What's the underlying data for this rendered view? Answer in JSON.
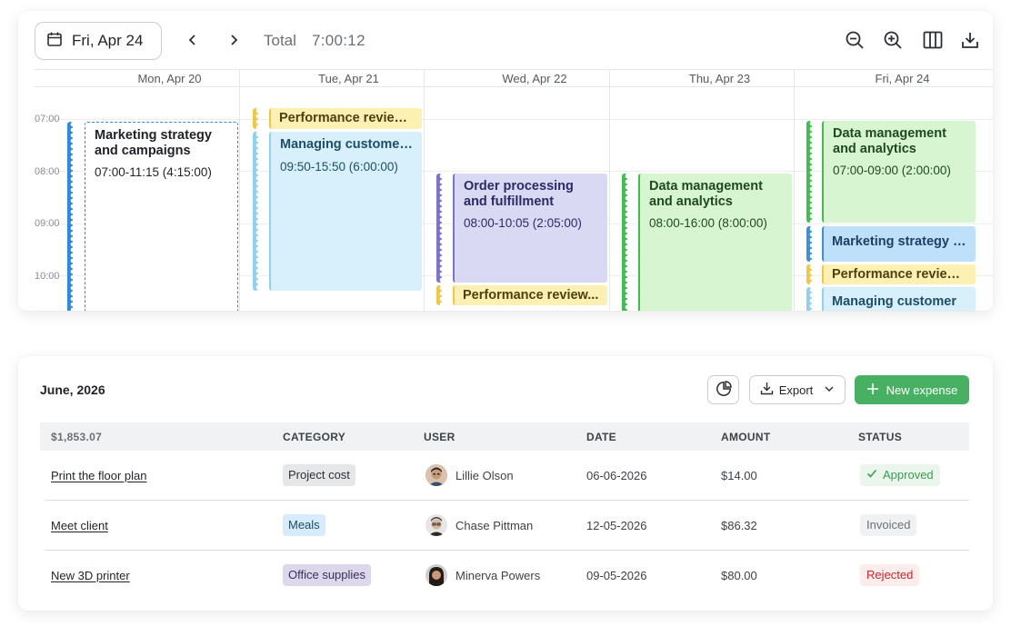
{
  "calendar": {
    "current_date": "Fri, Apr 24",
    "total_label": "Total",
    "total_value": "7:00:12",
    "days": [
      "Mon, Apr 20",
      "Tue, Apr 21",
      "Wed, Apr 22",
      "Thu, Apr 23",
      "Fri, Apr 24"
    ],
    "hours": [
      "07:00",
      "08:00",
      "09:00",
      "10:00"
    ],
    "events": {
      "mon_1": {
        "title": "Marketing strategy and campaigns",
        "time": "07:00-11:15 (4:15:00)"
      },
      "tue_1": {
        "title": "Performance review..."
      },
      "tue_2": {
        "title": "Managing customer...",
        "time": "09:50-15:50 (6:00:00)"
      },
      "wed_1": {
        "title": "Order processing and fulfillment",
        "time": "08:00-10:05 (2:05:00)"
      },
      "wed_2": {
        "title": "Performance review..."
      },
      "thu_1": {
        "title": "Data management and analytics",
        "time": "08:00-16:00 (8:00:00)"
      },
      "fri_1": {
        "title": "Data management and analytics",
        "time": "07:00-09:00 (2:00:00)"
      },
      "fri_2": {
        "title": "Marketing strategy a..."
      },
      "fri_3": {
        "title": "Performance review..."
      },
      "fri_4": {
        "title": "Managing customer"
      }
    }
  },
  "expenses": {
    "period": "June, 2026",
    "export_label": "Export",
    "new_label": "New expense",
    "columns": {
      "sum": "$1,853.07",
      "category": "CATEGORY",
      "user": "USER",
      "date": "DATE",
      "amount": "AMOUNT",
      "status": "STATUS"
    },
    "rows": [
      {
        "title": "Print the floor plan",
        "category": "Project cost",
        "user": "Lillie Olson",
        "date": "06-06-2026",
        "amount": "$14.00",
        "status": "Approved"
      },
      {
        "title": "Meet client",
        "category": "Meals",
        "user": "Chase Pittman",
        "date": "12-05-2026",
        "amount": "$86.32",
        "status": "Invoiced"
      },
      {
        "title": "New 3D printer",
        "category": "Office supplies",
        "user": "Minerva Powers",
        "date": "09-05-2026",
        "amount": "$80.00",
        "status": "Rejected"
      }
    ]
  },
  "colors": {
    "primary_green": "#48b063",
    "approved": "#3a9b52",
    "rejected": "#d2232a",
    "event_blue": "#3a8fe0",
    "event_green": "#3fbf4b",
    "event_purple": "#7a73d4",
    "event_yellow": "#f2c744"
  },
  "icons": [
    "calendar-icon",
    "chevron-left-icon",
    "chevron-right-icon",
    "zoom-out-icon",
    "zoom-in-icon",
    "columns-icon",
    "download-icon",
    "pie-chart-icon",
    "chevron-down-icon",
    "plus-icon",
    "check-icon"
  ]
}
